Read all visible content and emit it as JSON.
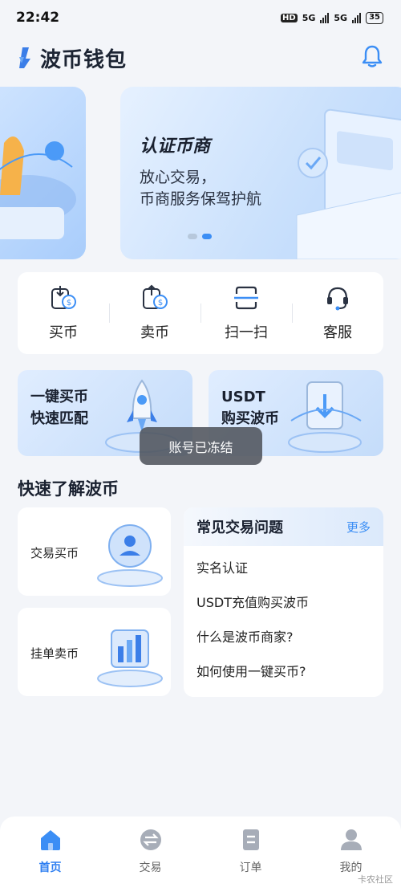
{
  "status_bar": {
    "time": "22:42",
    "hd": "HD",
    "network_1": "5G",
    "network_2": "5G",
    "battery": "35"
  },
  "header": {
    "app_name": "波币钱包"
  },
  "carousel": {
    "title": "认证币商",
    "subtitle_line1": "放心交易，",
    "subtitle_line2": "币商服务保驾护航"
  },
  "actions": [
    {
      "label": "买币",
      "icon": "buy-coin-icon"
    },
    {
      "label": "卖币",
      "icon": "sell-coin-icon"
    },
    {
      "label": "扫一扫",
      "icon": "scan-icon"
    },
    {
      "label": "客服",
      "icon": "headset-icon"
    }
  ],
  "promos": [
    {
      "line1": "一键买币",
      "line2": "快速匹配"
    },
    {
      "line1": "USDT",
      "line2": "购买波币"
    }
  ],
  "toast": "账号已冻结",
  "section": {
    "title": "快速了解波币"
  },
  "learn_cards": [
    {
      "label": "交易买币"
    },
    {
      "label": "挂单卖币"
    }
  ],
  "faq": {
    "title": "常见交易问题",
    "more": "更多",
    "items": [
      "实名认证",
      "USDT充值购买波币",
      "什么是波币商家?",
      "如何使用一键买币?"
    ]
  },
  "nav": [
    {
      "label": "首页",
      "icon": "home-icon",
      "active": true
    },
    {
      "label": "交易",
      "icon": "exchange-icon",
      "active": false
    },
    {
      "label": "订单",
      "icon": "order-icon",
      "active": false
    },
    {
      "label": "我的",
      "icon": "profile-icon",
      "active": false
    }
  ],
  "colors": {
    "accent": "#3b8ef5",
    "active_nav": "#2f7ff1",
    "background": "#f3f5f9"
  },
  "watermark": "卡农社区"
}
